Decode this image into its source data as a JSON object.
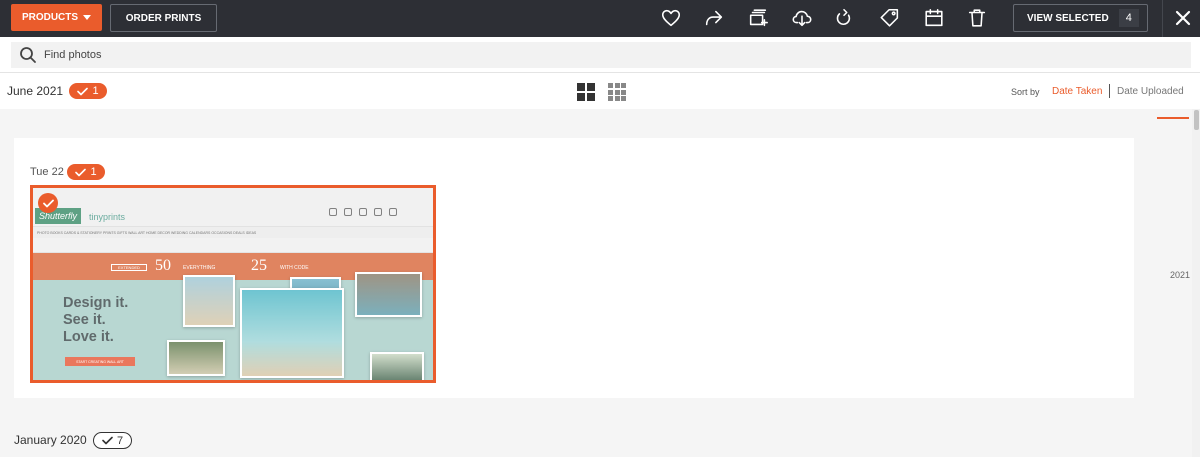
{
  "toolbar": {
    "products_label": "PRODUCTS",
    "order_prints_label": "ORDER PRINTS",
    "view_selected_label": "VIEW SELECTED",
    "view_selected_count": "4",
    "icons": [
      "heart-icon",
      "share-icon",
      "add-to-album-icon",
      "download-icon",
      "rotate-icon",
      "tag-icon",
      "calendar-icon",
      "delete-icon",
      "close-icon"
    ],
    "accent_color": "#ea5c2c",
    "bar_color": "#2d2f35"
  },
  "search": {
    "placeholder": "Find photos",
    "value": ""
  },
  "subheader": {
    "month_label": "June 2021",
    "month_count": "1",
    "sort_by_label": "Sort by",
    "sort_options": [
      "Date Taken",
      "Date Uploaded"
    ],
    "sort_selected": "Date Taken"
  },
  "timeline": {
    "year_label": "2021"
  },
  "day_group": {
    "label": "Tue 22",
    "count": "1",
    "photo": {
      "selected": true,
      "brand_a": "Shutterfly",
      "brand_b": "tinyprints",
      "nav_text": "PHOTO BOOKS   CARDS & STATIONERY   PRINTS   GIFTS   WALL ART   HOME DECOR   WEDDING   CALENDARS   OCCASIONS   DEALS   IDEAS",
      "banner_extended": "EXTENDED",
      "banner_big_1": "50",
      "banner_text_1": "EVERYTHING",
      "banner_big_2": "25",
      "banner_text_2": "WITH CODE",
      "headline_1": "Design it.",
      "headline_2": "See it.",
      "headline_3": "Love it.",
      "cta": "START CREATING WALL ART"
    }
  },
  "next_group": {
    "month_label": "January 2020",
    "count": "7"
  }
}
